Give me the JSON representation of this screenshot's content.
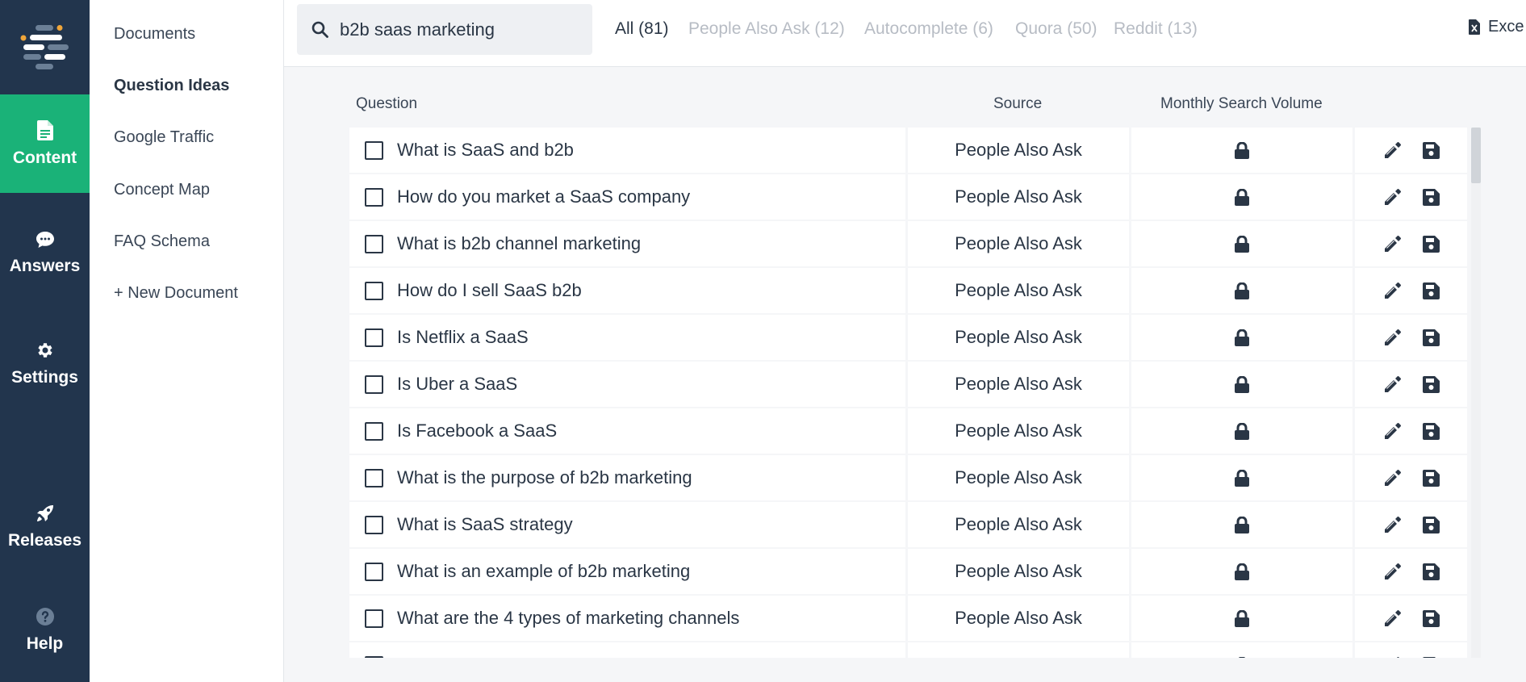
{
  "rail": {
    "items": [
      {
        "label": "Content",
        "icon": "document-icon",
        "active": true
      },
      {
        "label": "Answers",
        "icon": "chat-bubble-icon",
        "active": false
      },
      {
        "label": "Settings",
        "icon": "gear-icon",
        "active": false
      },
      {
        "label": "Releases",
        "icon": "rocket-icon",
        "active": false
      },
      {
        "label": "Help",
        "icon": "question-circle-icon",
        "active": false
      }
    ]
  },
  "subnav": {
    "items": [
      {
        "label": "Documents"
      },
      {
        "label": "Question Ideas",
        "active": true
      },
      {
        "label": "Google Traffic"
      },
      {
        "label": "Concept Map"
      },
      {
        "label": "FAQ Schema"
      },
      {
        "label": "+ New Document"
      }
    ]
  },
  "search": {
    "value": "b2b saas marketing",
    "icon": "search-icon"
  },
  "filters": [
    {
      "label": "All (81)",
      "active": true
    },
    {
      "label": "People Also Ask (12)"
    },
    {
      "label": "Autocomplete (6)"
    },
    {
      "label": "Quora (50)"
    },
    {
      "label": "Reddit (13)"
    }
  ],
  "export": {
    "label": "Exce",
    "icon": "excel-file-icon"
  },
  "table": {
    "headers": {
      "question": "Question",
      "source": "Source",
      "volume": "Monthly Search Volume"
    },
    "rows": [
      {
        "question": "What is SaaS and b2b",
        "source": "People Also Ask"
      },
      {
        "question": "How do you market a SaaS company",
        "source": "People Also Ask"
      },
      {
        "question": "What is b2b channel marketing",
        "source": "People Also Ask"
      },
      {
        "question": "How do I sell SaaS b2b",
        "source": "People Also Ask"
      },
      {
        "question": "Is Netflix a SaaS",
        "source": "People Also Ask"
      },
      {
        "question": "Is Uber a SaaS",
        "source": "People Also Ask"
      },
      {
        "question": "Is Facebook a SaaS",
        "source": "People Also Ask"
      },
      {
        "question": "What is the purpose of b2b marketing",
        "source": "People Also Ask"
      },
      {
        "question": "What is SaaS strategy",
        "source": "People Also Ask"
      },
      {
        "question": "What is an example of b2b marketing",
        "source": "People Also Ask"
      },
      {
        "question": "What are the 4 types of marketing channels",
        "source": "People Also Ask"
      },
      {
        "question": "",
        "source": ""
      }
    ]
  },
  "colors": {
    "rail": "#22354d",
    "accent": "#1ab278",
    "text": "#2a3645",
    "muted": "#b7bcc4"
  }
}
